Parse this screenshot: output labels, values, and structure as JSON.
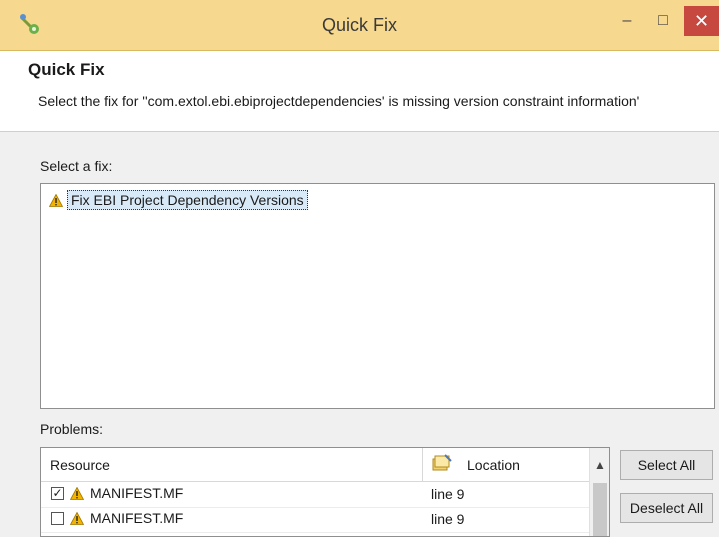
{
  "window": {
    "title": "Quick Fix",
    "minimize_glyph": "–",
    "maximize_glyph": "□",
    "close_glyph": "✕"
  },
  "header": {
    "title": "Quick Fix",
    "description": "Select the fix for ''com.extol.ebi.ebiprojectdependencies' is missing version constraint information'"
  },
  "fixes": {
    "label": "Select a fix:",
    "items": [
      {
        "label": "Fix EBI Project Dependency Versions",
        "icon": "warning-icon"
      }
    ]
  },
  "problems": {
    "label": "Problems:",
    "columns": {
      "resource": "Resource",
      "location": "Location"
    },
    "rows": [
      {
        "checked": true,
        "resource": "MANIFEST.MF",
        "location": "line 9",
        "icon": "warning-icon"
      },
      {
        "checked": false,
        "resource": "MANIFEST.MF",
        "location": "line 9",
        "icon": "warning-icon"
      }
    ],
    "check_glyph": "✓",
    "scroll_up_glyph": "▲"
  },
  "buttons": {
    "select_all": "Select All",
    "deselect_all": "Deselect All"
  },
  "colors": {
    "titlebar": "#f6d88e",
    "close": "#c7483f",
    "selection": "#d8e9f7",
    "warning": "#f2b400"
  }
}
